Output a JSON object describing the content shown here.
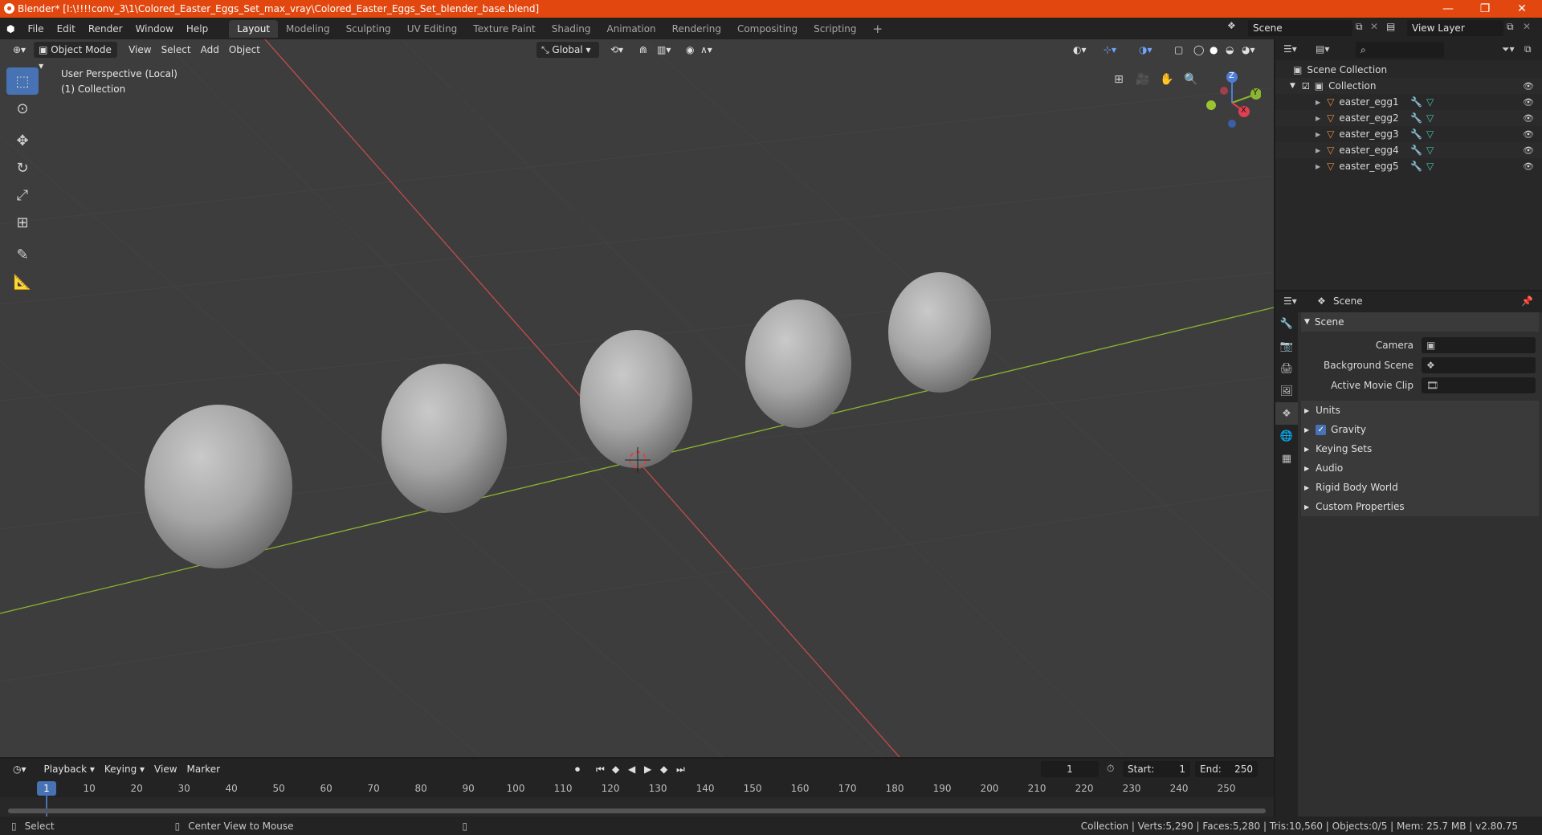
{
  "window": {
    "title": "Blender* [I:\\!!!!conv_3\\1\\Colored_Easter_Eggs_Set_max_vray\\Colored_Easter_Eggs_Set_blender_base.blend]",
    "minimize": "—",
    "maximize": "❐",
    "close": "✕"
  },
  "menus": [
    "File",
    "Edit",
    "Render",
    "Window",
    "Help"
  ],
  "workspaces": [
    "Layout",
    "Modeling",
    "Sculpting",
    "UV Editing",
    "Texture Paint",
    "Shading",
    "Animation",
    "Rendering",
    "Compositing",
    "Scripting"
  ],
  "add_workspace": "+",
  "scene_field": "Scene",
  "view_layer_field": "View Layer",
  "viewport": {
    "mode": "Object Mode",
    "menus": [
      "View",
      "Select",
      "Add",
      "Object"
    ],
    "orientation": "Global",
    "perspective_label": "User Perspective (Local)",
    "collection_label": "(1) Collection",
    "gizmo_labels": {
      "z": "Z",
      "y": "Y",
      "x": "X"
    }
  },
  "outliner": {
    "search_placeholder": "",
    "scene_collection": "Scene Collection",
    "collection": "Collection",
    "objects": [
      "easter_egg1",
      "easter_egg2",
      "easter_egg3",
      "easter_egg4",
      "easter_egg5"
    ]
  },
  "properties": {
    "header_title": "Scene",
    "section_title": "Scene",
    "camera_label": "Camera",
    "background_scene_label": "Background Scene",
    "active_movie_clip_label": "Active Movie Clip",
    "panels": [
      "Units",
      "Gravity",
      "Keying Sets",
      "Audio",
      "Rigid Body World",
      "Custom Properties"
    ],
    "gravity_checked": true
  },
  "timeline": {
    "menus": [
      "Playback",
      "Keying",
      "View",
      "Marker"
    ],
    "current_frame": "1",
    "start_label": "Start:",
    "start_value": "1",
    "end_label": "End:",
    "end_value": "250",
    "frame_marks": [
      "10",
      "20",
      "30",
      "40",
      "50",
      "60",
      "70",
      "80",
      "90",
      "100",
      "110",
      "120",
      "130",
      "140",
      "150",
      "160",
      "170",
      "180",
      "190",
      "200",
      "210",
      "220",
      "230",
      "240",
      "250"
    ],
    "current_frame_marker": "1"
  },
  "statusbar": {
    "select": "Select",
    "center_view": "Center View to Mouse",
    "stats": "Collection | Verts:5,290 | Faces:5,280 | Tris:10,560 | Objects:0/5 | Mem: 25.7 MB | v2.80.75"
  },
  "colors": {
    "titlebar": "#e2470f",
    "accent": "#4772b3",
    "x_axis": "#c44c4c",
    "y_axis": "#8ab530",
    "object_icon": "#ef8f35",
    "mesh_icon": "#49c3b1"
  }
}
